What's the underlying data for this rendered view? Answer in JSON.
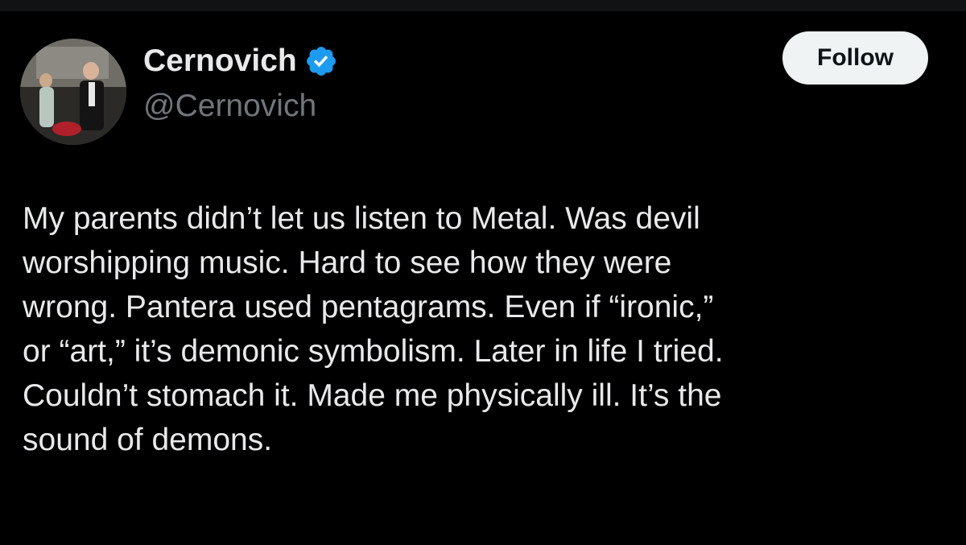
{
  "tweet": {
    "author": {
      "display_name": "Cernovich",
      "handle": "@Cernovich",
      "verified_icon": "verified-badge-icon",
      "verified_color": "#1d9bf0"
    },
    "follow_label": "Follow",
    "text_lines": [
      "My parents didn’t let us listen to Metal. Was devil",
      "worshipping music. Hard to see how they were",
      "wrong. Pantera used pentagrams. Even if “ironic,”",
      "or “art,” it’s demonic symbolism. Later in life I tried.",
      "Couldn’t stomach it. Made me physically ill. It’s the",
      "sound of demons."
    ]
  },
  "colors": {
    "background": "#000000",
    "text_primary": "#e7e9ea",
    "text_secondary": "#71767b",
    "follow_button_bg": "#eff3f4",
    "follow_button_text": "#0f1419"
  }
}
